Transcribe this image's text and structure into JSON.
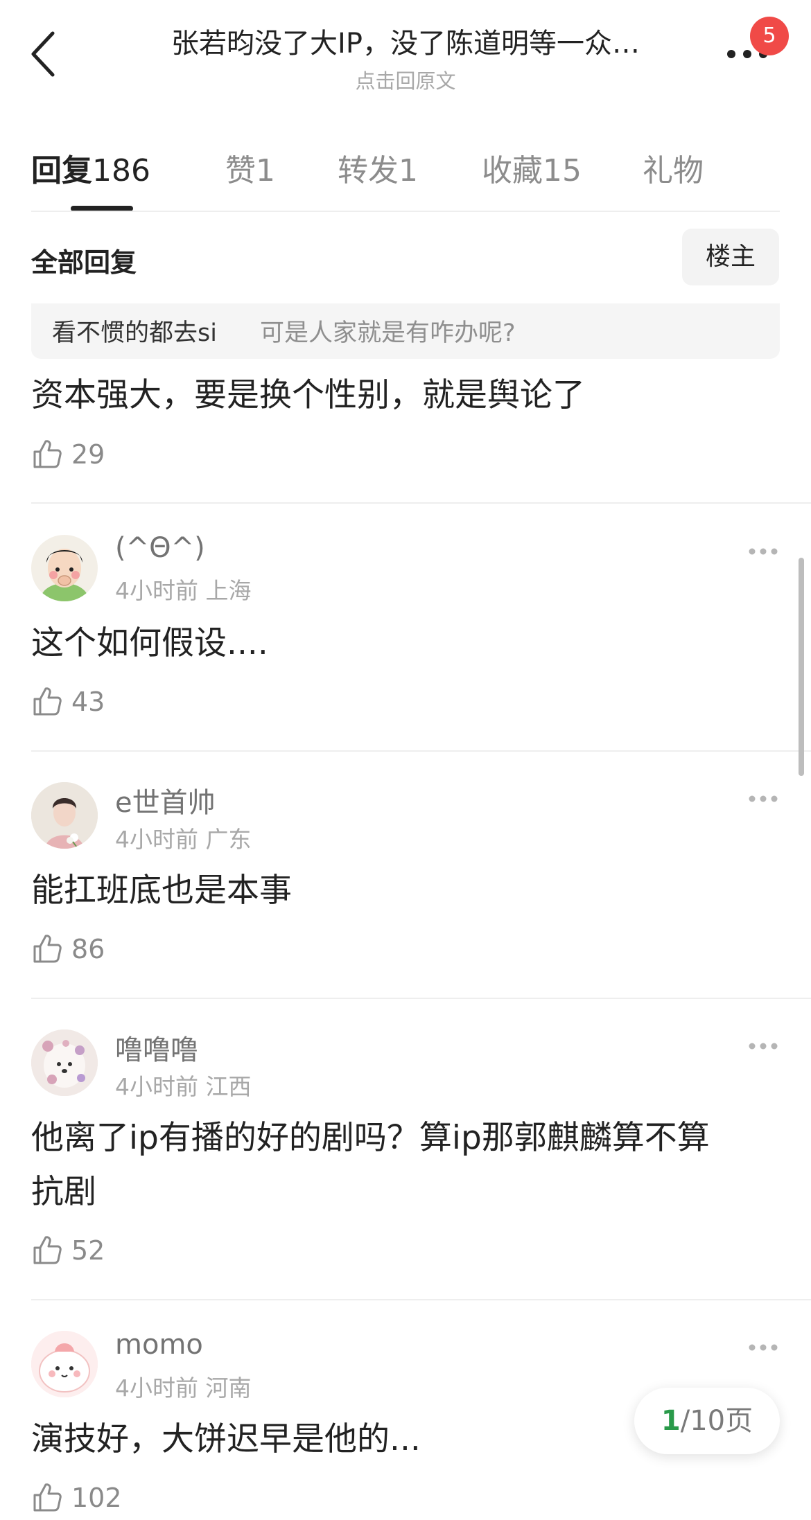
{
  "header": {
    "title": "张若昀没了大IP，没了陈道明等一众…",
    "subtitle": "点击回原文",
    "notification_count": "5"
  },
  "tabs": [
    {
      "label": "回复",
      "count": "186"
    },
    {
      "label": "赞",
      "count": "1"
    },
    {
      "label": "转发",
      "count": "1"
    },
    {
      "label": "收藏",
      "count": "15"
    },
    {
      "label": "礼物",
      "count": ""
    }
  ],
  "section": {
    "title": "全部回复",
    "owner_button": "楼主"
  },
  "top_reply": {
    "quote_user": "看不惯的都去si",
    "quote_text": "可是人家就是有咋办呢?",
    "content": "资本强大，要是换个性别，就是舆论了",
    "likes": "29"
  },
  "comments": [
    {
      "username": "(^Θ^)",
      "time": "4小时前",
      "location": "上海",
      "content": "这个如何假设....",
      "likes": "43"
    },
    {
      "username": "e世首帅",
      "time": "4小时前",
      "location": "广东",
      "content": "能扛班底也是本事",
      "likes": "86"
    },
    {
      "username": "噜噜噜",
      "time": "4小时前",
      "location": "江西",
      "content_line1": "他离了ip有播的好的剧吗？算ip那郭麒麟算不算",
      "content_line2": "抗剧",
      "likes": "52"
    },
    {
      "username": "momo",
      "time": "4小时前",
      "location": "河南",
      "content": "演技好，大饼迟早是他的...",
      "likes": "102"
    }
  ],
  "pager": {
    "current": "1",
    "total": "/10",
    "unit": "页"
  },
  "colors": {
    "badge": "#f04a47",
    "pager_current": "#2a9a4a",
    "muted_text": "#a8a8a8"
  }
}
